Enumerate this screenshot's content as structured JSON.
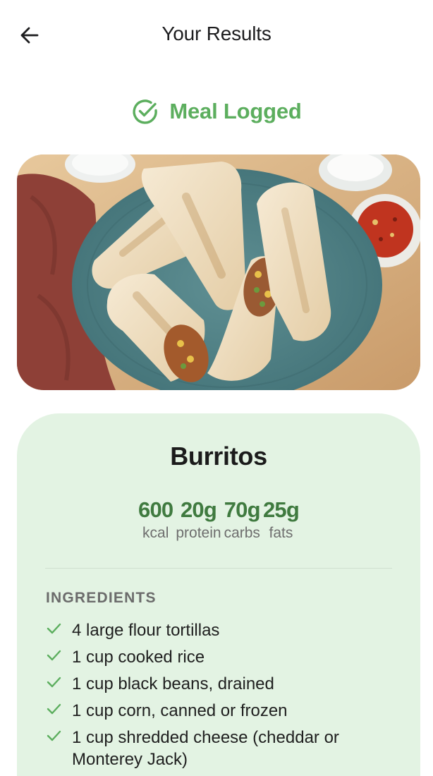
{
  "header": {
    "title": "Your Results",
    "back_icon": "arrow-left-icon"
  },
  "status": {
    "text": "Meal Logged",
    "icon": "check-circle-icon",
    "color": "#5cae5e"
  },
  "meal": {
    "name": "Burritos",
    "macros": [
      {
        "value": "600",
        "unit": "kcal"
      },
      {
        "value": "20g",
        "unit": "protein"
      },
      {
        "value": "70g",
        "unit": "carbs"
      },
      {
        "value": "25g",
        "unit": "fats"
      }
    ]
  },
  "ingredients": {
    "title": "INGREDIENTS",
    "items": [
      "4 large flour tortillas",
      "1 cup cooked rice",
      "1 cup black beans, drained",
      "1 cup corn, canned or frozen",
      "1 cup shredded cheese (cheddar or Monterey Jack)"
    ]
  },
  "colors": {
    "accent": "#5cae5e",
    "macro_value": "#3f7a3f",
    "card_background": "#e3f3e3"
  }
}
